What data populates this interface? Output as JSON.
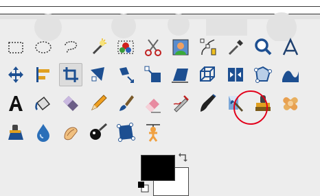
{
  "colors": {
    "foreground": "#000000",
    "background": "#ffffff",
    "highlight_circle": "#e2001a"
  },
  "toolbox": {
    "rows": [
      [
        "rect-select-icon",
        "ellipse-select-icon",
        "free-select-icon",
        "fuzzy-select-icon",
        "select-by-color-icon",
        "scissors-select-icon",
        "foreground-select-icon",
        "paths-icon",
        "color-picker-icon",
        "zoom-icon",
        "measure-icon"
      ],
      [
        "move-icon",
        "align-icon",
        "crop-icon",
        "rotate-icon",
        "scale-icon",
        "shear-icon",
        "perspective-icon",
        "3d-transform-icon",
        "flip-icon",
        "cage-transform-icon",
        "warp-transform-icon"
      ],
      [
        "text-icon",
        "bucket-fill-icon",
        "blend-icon",
        "pencil-icon",
        "paintbrush-icon",
        "eraser-icon",
        "airbrush-icon",
        "ink-icon",
        "mypaint-brush-icon",
        "clone-icon",
        "heal-icon"
      ],
      [
        "perspective-clone-icon",
        "blur-sharpen-icon",
        "smudge-icon",
        "dodge-burn-icon",
        "unified-transform-icon",
        "puppet-warp-icon"
      ]
    ],
    "active_tool": "crop-icon",
    "highlighted_tool": "mypaint-brush-icon"
  }
}
